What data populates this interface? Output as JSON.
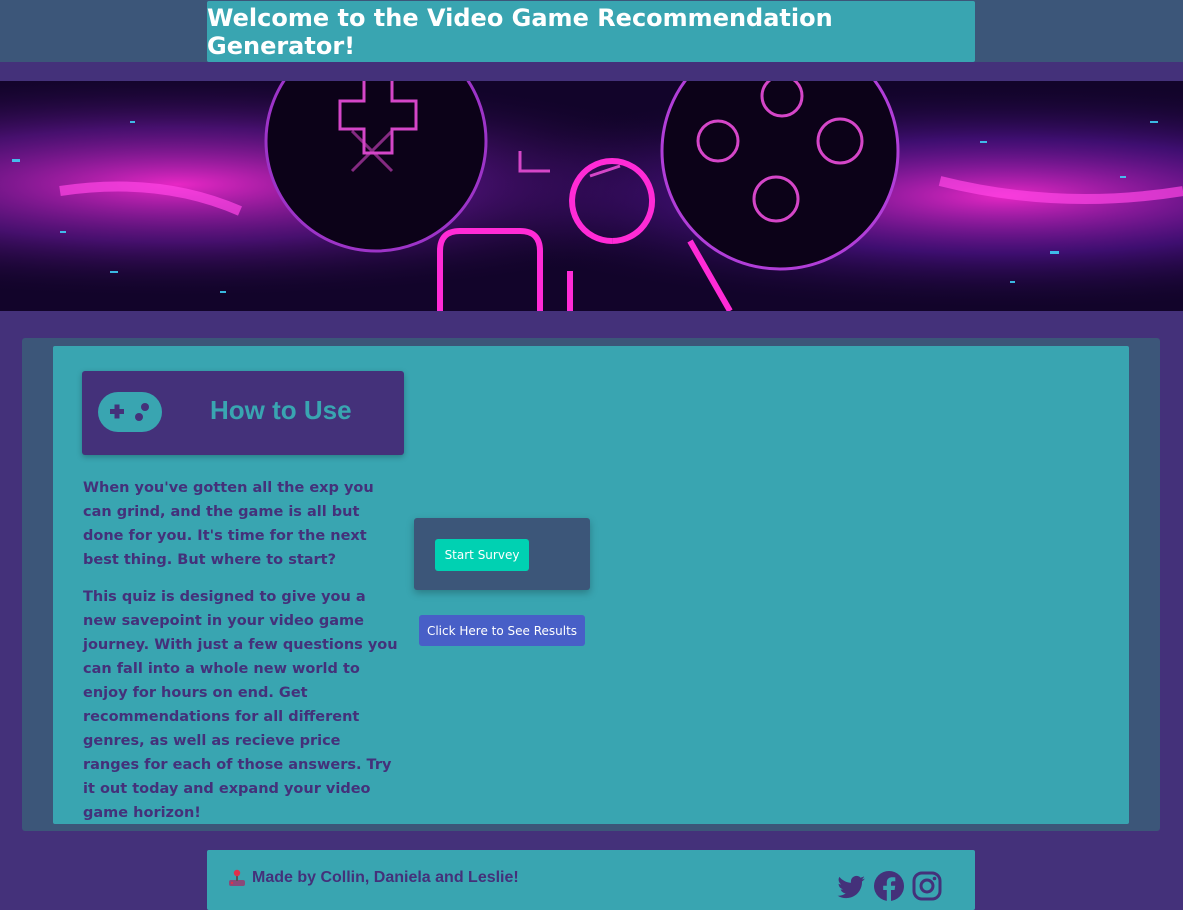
{
  "header": {
    "title": "Welcome to the Video Game Recommendation Generator!"
  },
  "banner": {
    "icon": "game-controller-neon-banner"
  },
  "how_to_use": {
    "heading": "How to Use",
    "icon": "gamepad-icon",
    "paragraph_1": "When you've gotten all the exp you can grind, and the game is all but done for you. It's time for the next best thing. But where to start?",
    "paragraph_2": "This quiz is designed to give you a new savepoint in your video game journey. With just a few questions you can fall into a whole new world to enjoy for hours on end. Get recommendations for all different genres, as well as recieve price ranges for each of those answers. Try it out today and expand your video game horizon!"
  },
  "actions": {
    "start_survey": "Start Survey",
    "see_results": "Click Here to See Results"
  },
  "footer": {
    "credits": "Made by Collin, Daniela and Leslie!",
    "credits_icon": "joystick-icon",
    "social": [
      "twitter-icon",
      "facebook-icon",
      "instagram-icon"
    ]
  },
  "colors": {
    "background": "#44317a",
    "header_band": "#3c5679",
    "teal": "#39a5b1",
    "start_button": "#00d1b2",
    "results_button": "#485fc7",
    "text_purple": "#44317a"
  }
}
